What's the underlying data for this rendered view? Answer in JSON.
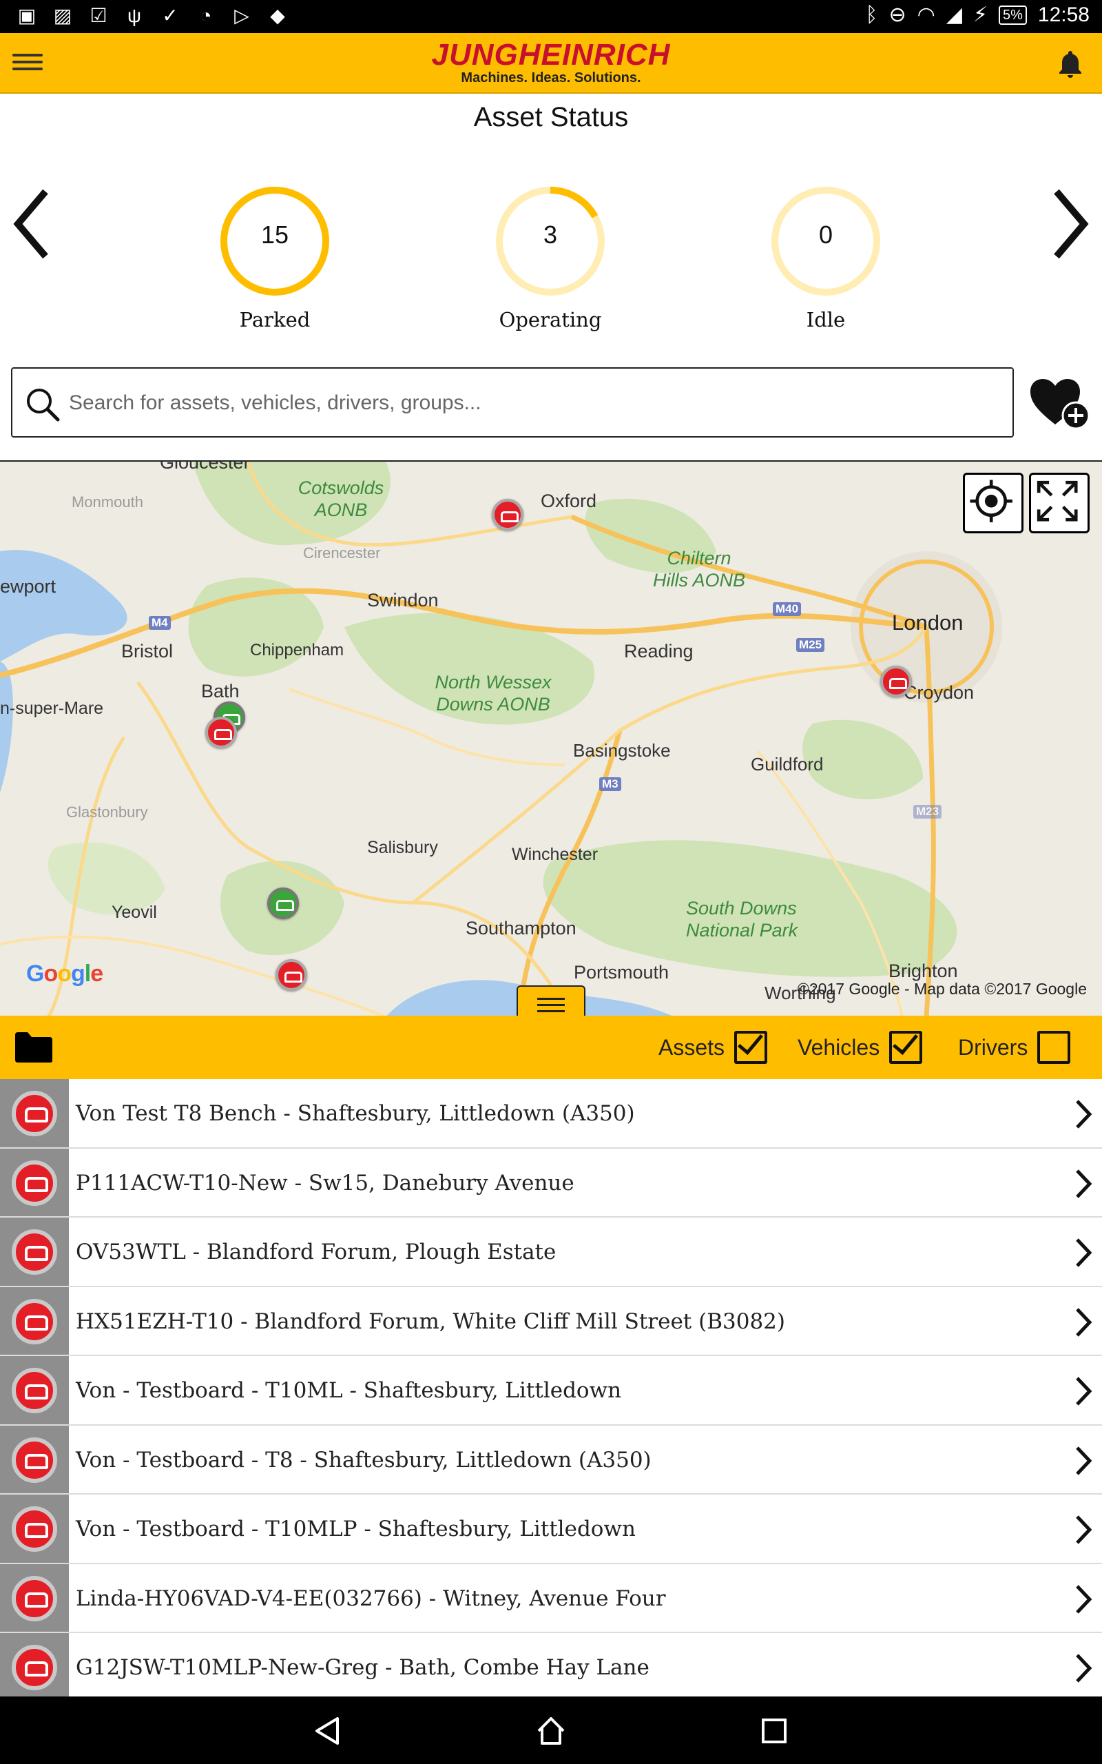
{
  "status_bar": {
    "time": "12:58",
    "battery": "5%"
  },
  "header": {
    "brand_name": "JUNGHEINRICH",
    "brand_tagline": "Machines. Ideas. Solutions.",
    "brand_color": "#FFBD00"
  },
  "asset_status": {
    "title": "Asset Status",
    "gauges": [
      {
        "label": "Parked",
        "count": "15",
        "fill": 1.0
      },
      {
        "label": "Operating",
        "count": "3",
        "fill": 0.17
      },
      {
        "label": "Idle",
        "count": "0",
        "fill": 0.0
      }
    ]
  },
  "search": {
    "placeholder": "Search for assets, vehicles, drivers, groups..."
  },
  "map": {
    "labels": {
      "gloucester": "Gloucester",
      "monmouth": "Monmouth",
      "cotswolds": "Cotswolds AONB",
      "oxford": "Oxford",
      "cirencester": "Cirencester",
      "chiltern": "Chiltern Hills AONB",
      "newport": "ewport",
      "swindon": "Swindon",
      "london": "London",
      "bristol": "Bristol",
      "chippenham": "Chippenham",
      "reading": "Reading",
      "bath": "Bath",
      "croydon": "Croydon",
      "weston": "n-super-Mare",
      "north_wessex": "North Wessex Downs AONB",
      "basingstoke": "Basingstoke",
      "guildford": "Guildford",
      "glastonbury": "Glastonbury",
      "salisbury": "Salisbury",
      "winchester": "Winchester",
      "yeovil": "Yeovil",
      "southampton": "Southampton",
      "south_downs": "South Downs National Park",
      "portsmouth": "Portsmouth",
      "brighton": "Brighton",
      "worthing": "Worthing"
    },
    "shields": {
      "m4": "M4",
      "m40": "M40",
      "m25": "M25",
      "m3": "M3",
      "m23": "M23"
    },
    "attribution": "©2017 Google - Map data ©2017 Google",
    "google_logo": [
      "G",
      "o",
      "o",
      "g",
      "l",
      "e"
    ]
  },
  "filters": {
    "assets": {
      "label": "Assets",
      "checked": true
    },
    "vehicles": {
      "label": "Vehicles",
      "checked": true
    },
    "drivers": {
      "label": "Drivers",
      "checked": false
    }
  },
  "assets": [
    "Von Test T8 Bench - Shaftesbury, Littledown (A350)",
    "P111ACW-T10-New - Sw15, Danebury Avenue",
    "OV53WTL - Blandford Forum, Plough Estate",
    "HX51EZH-T10 - Blandford Forum, White Cliff Mill Street (B3082)",
    "Von - Testboard - T10ML - Shaftesbury, Littledown",
    "Von - Testboard - T8 - Shaftesbury, Littledown (A350)",
    "Von - Testboard - T10MLP - Shaftesbury, Littledown",
    "Linda-HY06VAD-V4-EE(032766) - Witney, Avenue Four",
    "G12JSW-T10MLP-New-Greg - Bath, Combe Hay Lane"
  ]
}
